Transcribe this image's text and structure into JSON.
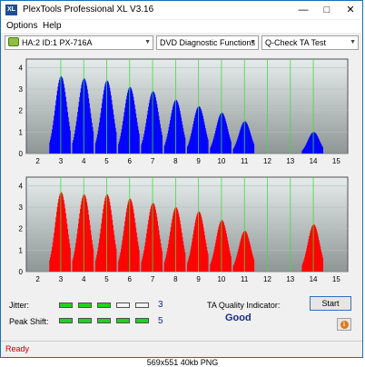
{
  "window": {
    "title": "PlexTools Professional XL V3.16",
    "app_icon_text": "XL"
  },
  "menu": [
    "Options",
    "Help"
  ],
  "toolbar": {
    "drive": "HA:2 ID:1  PX-716A",
    "function": "DVD Diagnostic Functions",
    "test": "Q-Check TA Test"
  },
  "chart_data": [
    {
      "type": "bar",
      "title": "",
      "series": [
        {
          "color": "#0000ff"
        }
      ],
      "x_ticks": [
        2,
        3,
        4,
        5,
        6,
        7,
        8,
        9,
        10,
        11,
        12,
        13,
        14,
        15
      ],
      "y_ticks": [
        0,
        1,
        2,
        3,
        4
      ],
      "xlim": [
        1.5,
        15.5
      ],
      "ylim": [
        0,
        4.4
      ],
      "grid": true,
      "peaks": [
        {
          "x": 3,
          "y": 3.6
        },
        {
          "x": 4,
          "y": 3.5
        },
        {
          "x": 5,
          "y": 3.4
        },
        {
          "x": 6,
          "y": 3.1
        },
        {
          "x": 7,
          "y": 2.9
        },
        {
          "x": 8,
          "y": 2.5
        },
        {
          "x": 9,
          "y": 2.2
        },
        {
          "x": 10,
          "y": 1.9
        },
        {
          "x": 11,
          "y": 1.5
        },
        {
          "x": 14,
          "y": 1.0
        }
      ]
    },
    {
      "type": "bar",
      "title": "",
      "series": [
        {
          "color": "#ff0000"
        }
      ],
      "x_ticks": [
        2,
        3,
        4,
        5,
        6,
        7,
        8,
        9,
        10,
        11,
        12,
        13,
        14,
        15
      ],
      "y_ticks": [
        0,
        1,
        2,
        3,
        4
      ],
      "xlim": [
        1.5,
        15.5
      ],
      "ylim": [
        0,
        4.4
      ],
      "grid": true,
      "peaks": [
        {
          "x": 3,
          "y": 3.7
        },
        {
          "x": 4,
          "y": 3.6
        },
        {
          "x": 5,
          "y": 3.6
        },
        {
          "x": 6,
          "y": 3.4
        },
        {
          "x": 7,
          "y": 3.2
        },
        {
          "x": 8,
          "y": 3.0
        },
        {
          "x": 9,
          "y": 2.8
        },
        {
          "x": 10,
          "y": 2.4
        },
        {
          "x": 11,
          "y": 1.9
        },
        {
          "x": 14,
          "y": 2.2
        }
      ]
    }
  ],
  "metrics": {
    "jitter_label": "Jitter:",
    "jitter_value": "3",
    "jitter_level": 3,
    "peak_label": "Peak Shift:",
    "peak_value": "5",
    "peak_level": 5,
    "segments_total": 5
  },
  "ta": {
    "label": "TA Quality Indicator:",
    "result": "Good"
  },
  "buttons": {
    "start": "Start",
    "info_glyph": "i"
  },
  "status": {
    "text": "Ready"
  },
  "caption": "569x551  40kb  PNG"
}
